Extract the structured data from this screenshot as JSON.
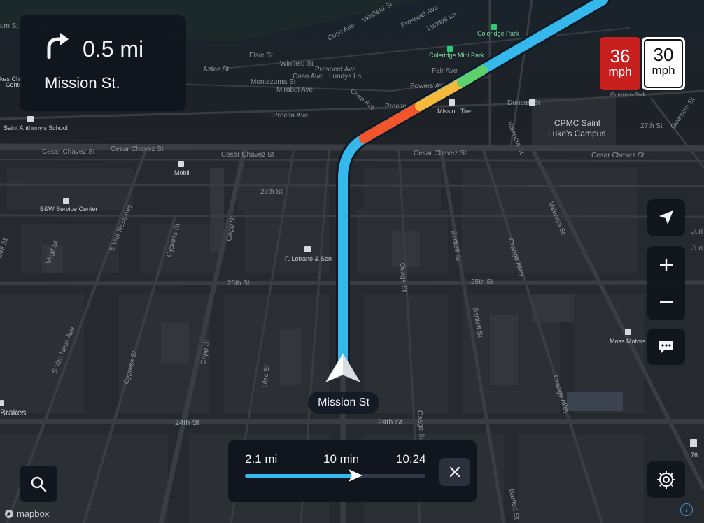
{
  "maneuver": {
    "icon": "turn-right-arrow-icon",
    "distance": "0.5 mi",
    "street": "Mission St."
  },
  "speed": {
    "current_value": "36",
    "current_unit": "mph",
    "limit_value": "30",
    "limit_unit": "mph",
    "current_color": "#c81f1f"
  },
  "map": {
    "current_street": "Mission St",
    "streets": [
      "Cesar Chavez St",
      "Cesar Chavez St",
      "Cesar Chavez St",
      "Cesar Chavez St",
      "Cesar Chavez St",
      "26th St",
      "25th St",
      "25th St",
      "24th St",
      "24th St",
      "Precita Ave",
      "Precita Ave",
      "Powers Ave",
      "Coso Ave",
      "Coso Ave",
      "Mirabel Ave",
      "Montezuma St",
      "Winfield St",
      "Aztec St",
      "Elsie St",
      "Prospect Ave",
      "Lundys Ln",
      "Fair Ave",
      "Valencia St",
      "Valencia St",
      "Duncan St",
      "27th St",
      "Guerrero St",
      "Guerrero Park",
      "S Van Ness Ave",
      "S Van Ness Ave",
      "Virgil St",
      "Cypress St",
      "Cypress St",
      "Capp St",
      "Capp St",
      "Lilac St",
      "Osage St",
      "Osage St",
      "Bartlett St",
      "Bartlett St",
      "Bartlett St",
      "Orange Alley",
      "Orange Alley",
      "Shotwell St",
      "Juri"
    ],
    "pois": [
      "Mobil",
      "B&W Service Center",
      "F. Lofrano & Son",
      "Mission Tire",
      "Coleridge Mini Park",
      "Coleridge Park",
      "CPMC Saint Luke's Campus",
      "Saint Anthony's School",
      "Moss Motors",
      "Brakes",
      "76"
    ],
    "route_colors": {
      "normal": "#35b8ec",
      "moderate": "#f6b93b",
      "heavy": "#f2552c"
    }
  },
  "trip": {
    "distance": "2.1 mi",
    "duration": "10 min",
    "eta": "10:24",
    "progress": 0.62
  },
  "controls": {
    "locate": "location-arrow-icon",
    "zoom_in": "plus-icon",
    "zoom_out": "minus-icon",
    "feedback": "chat-bubble-icon",
    "settings": "gear-icon",
    "search": "search-icon",
    "close": "close-icon"
  },
  "branding": {
    "logo_text": "mapbox"
  }
}
